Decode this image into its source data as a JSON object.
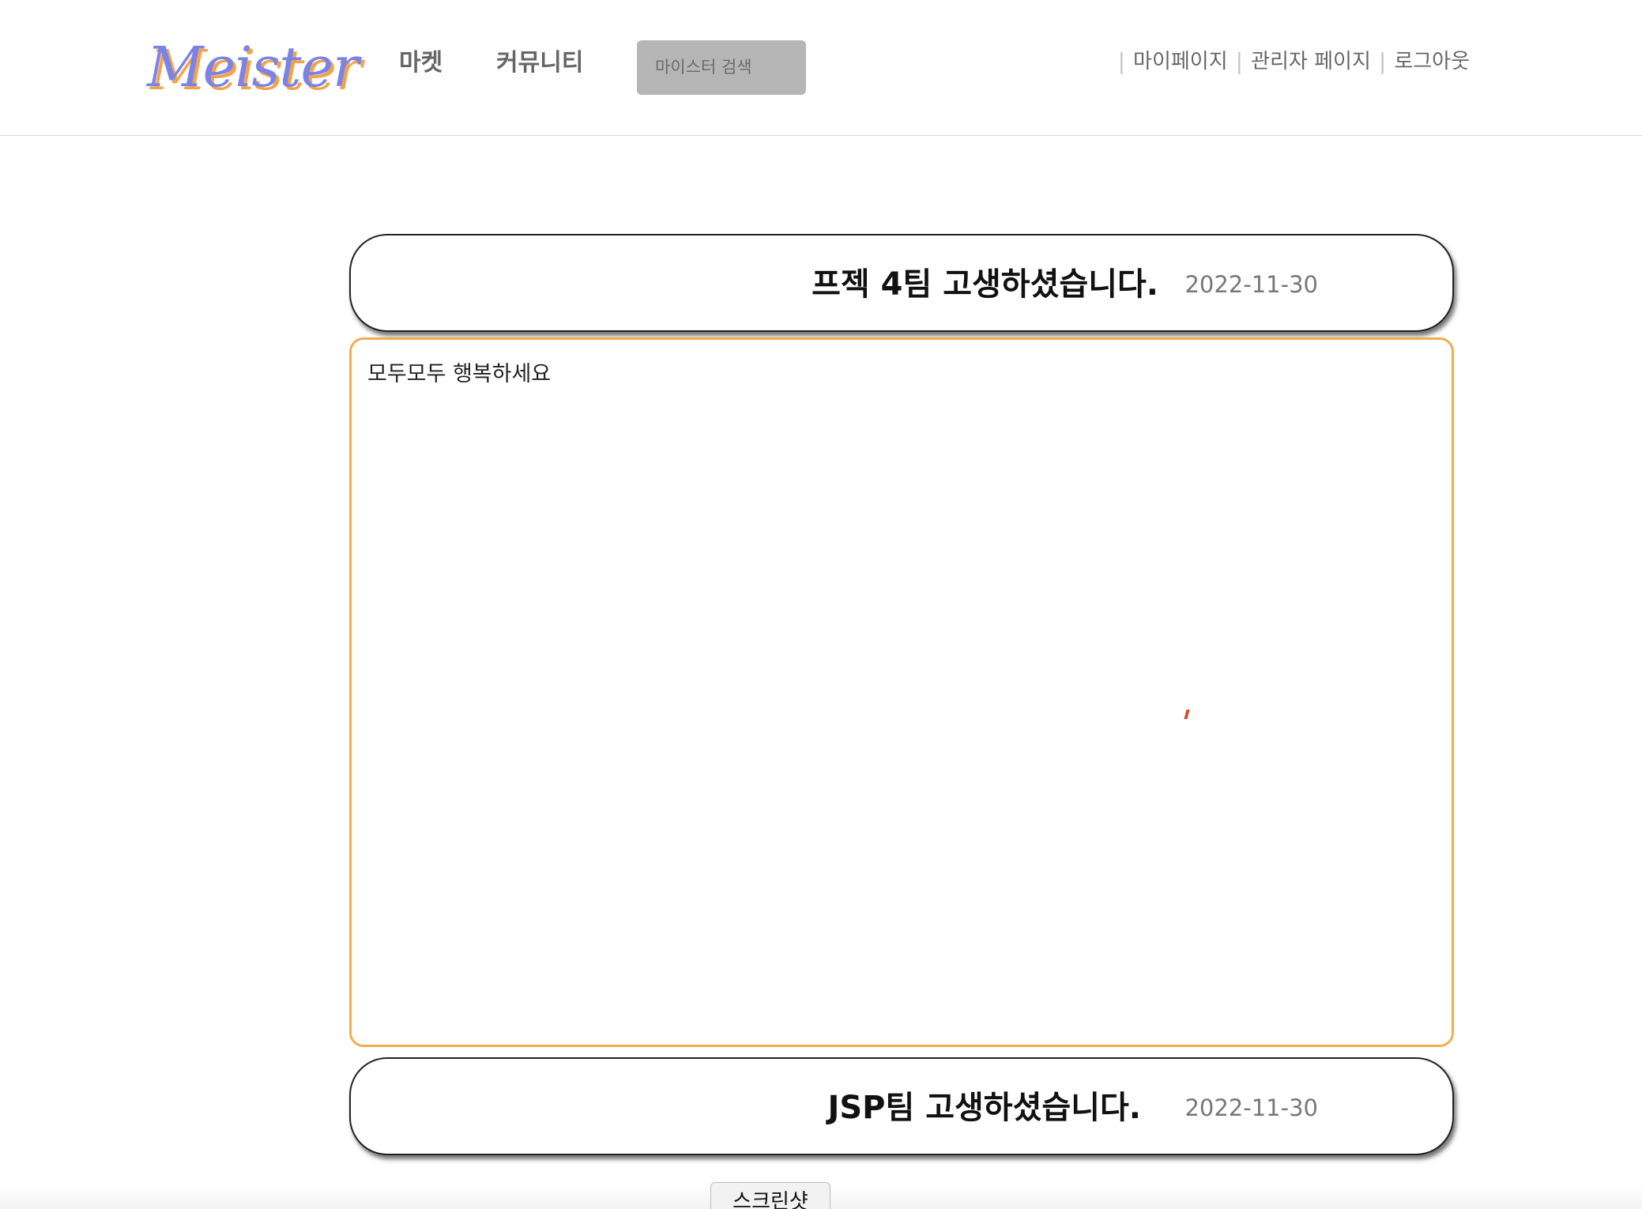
{
  "header": {
    "logo": "Meister",
    "nav": {
      "market": "마켓",
      "community": "커뮤니티"
    },
    "search": {
      "placeholder": "마이스터 검색"
    },
    "user_links": {
      "mypage": "마이페이지",
      "admin": "관리자 페이지",
      "logout": "로그아웃"
    }
  },
  "posts": [
    {
      "title": "프젝 4팀 고생하셨습니다.",
      "date": "2022-11-30",
      "content": "모두모두 행복하세요"
    },
    {
      "title": "JSP팀 고생하셨습니다.",
      "date": "2022-11-30"
    }
  ],
  "actions": {
    "screenshot": "스크린샷"
  },
  "colors": {
    "accent": "#f0ad4e",
    "logo": "#7b83e6",
    "search_bg": "#b6b6b6"
  }
}
